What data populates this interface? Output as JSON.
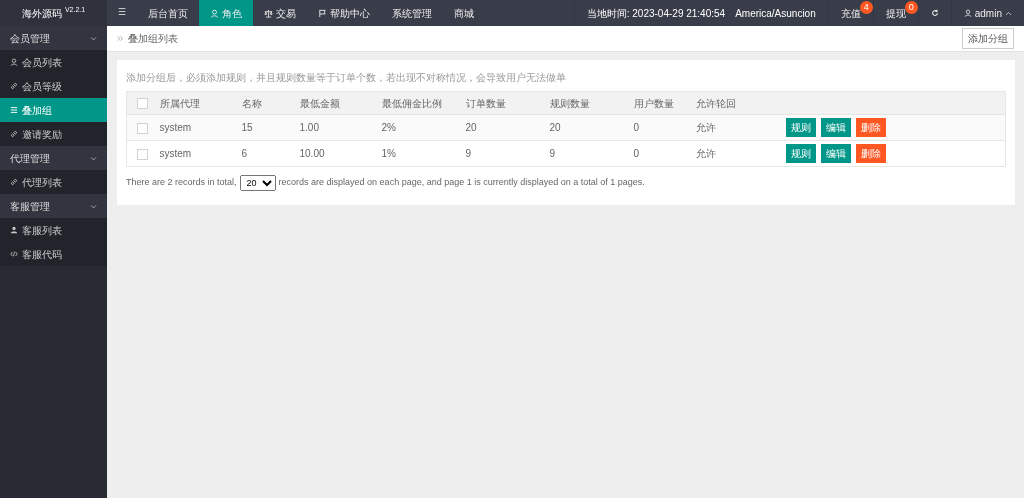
{
  "brand": {
    "name": "海外源码",
    "version": "V2.2.1"
  },
  "topnav": [
    {
      "label": "☰",
      "selected": false
    },
    {
      "label": "后台首页",
      "selected": false
    },
    {
      "label": "角色",
      "selected": true
    },
    {
      "label": "交易",
      "selected": false
    },
    {
      "label": "帮助中心",
      "selected": false
    },
    {
      "label": "系统管理",
      "selected": false
    },
    {
      "label": "商城",
      "selected": false
    }
  ],
  "topright": {
    "time": "当地时间: 2023-04-29 21:40:54",
    "timezone": "America/Asuncion",
    "badges": [
      {
        "label": "充值",
        "count": "4"
      },
      {
        "label": "提现",
        "count": "0"
      }
    ],
    "user": "admin"
  },
  "sidebar": [
    {
      "label": "会员管理",
      "expanded": true,
      "children": [
        {
          "label": "会员列表",
          "selected": false
        },
        {
          "label": "会员等级",
          "selected": false
        },
        {
          "label": "叠加组",
          "selected": true
        },
        {
          "label": "邀请奖励",
          "selected": false
        }
      ]
    },
    {
      "label": "代理管理",
      "expanded": true,
      "children": [
        {
          "label": "代理列表",
          "selected": false
        }
      ]
    },
    {
      "label": "客服管理",
      "expanded": true,
      "children": [
        {
          "label": "客服列表",
          "selected": false
        },
        {
          "label": "客服代码",
          "selected": false
        }
      ]
    }
  ],
  "breadcrumb": "叠加组列表",
  "add_button": "添加分组",
  "hint": "添加分组后，必须添加规则，并且规则数量等于订单个数，若出现不对称情况，会导致用户无法做单",
  "table": {
    "select_all": {
      "checked": false
    },
    "columns": [
      "所属代理",
      "名称",
      "最低金额",
      "最低佣金比例",
      "订单数量",
      "规则数量",
      "用户数量",
      "允许轮回"
    ],
    "rows": [
      {
        "checked": false,
        "cells": [
          "system",
          "15",
          "1.00",
          "2%",
          "20",
          "20",
          "0",
          "允许"
        ],
        "actions": [
          {
            "label": "规则",
            "kind": "primary"
          },
          {
            "label": "编辑",
            "kind": "primary"
          },
          {
            "label": "删除",
            "kind": "danger"
          }
        ]
      },
      {
        "checked": false,
        "cells": [
          "system",
          "6",
          "10.00",
          "1%",
          "9",
          "9",
          "0",
          "允许"
        ],
        "actions": [
          {
            "label": "规则",
            "kind": "primary"
          },
          {
            "label": "编辑",
            "kind": "primary"
          },
          {
            "label": "删除",
            "kind": "danger"
          }
        ]
      }
    ]
  },
  "pager": {
    "before": "There are 2 records in total,",
    "page_size": "20",
    "after": "records are displayed on each page, and page 1 is currently displayed on a total of 1 pages."
  }
}
